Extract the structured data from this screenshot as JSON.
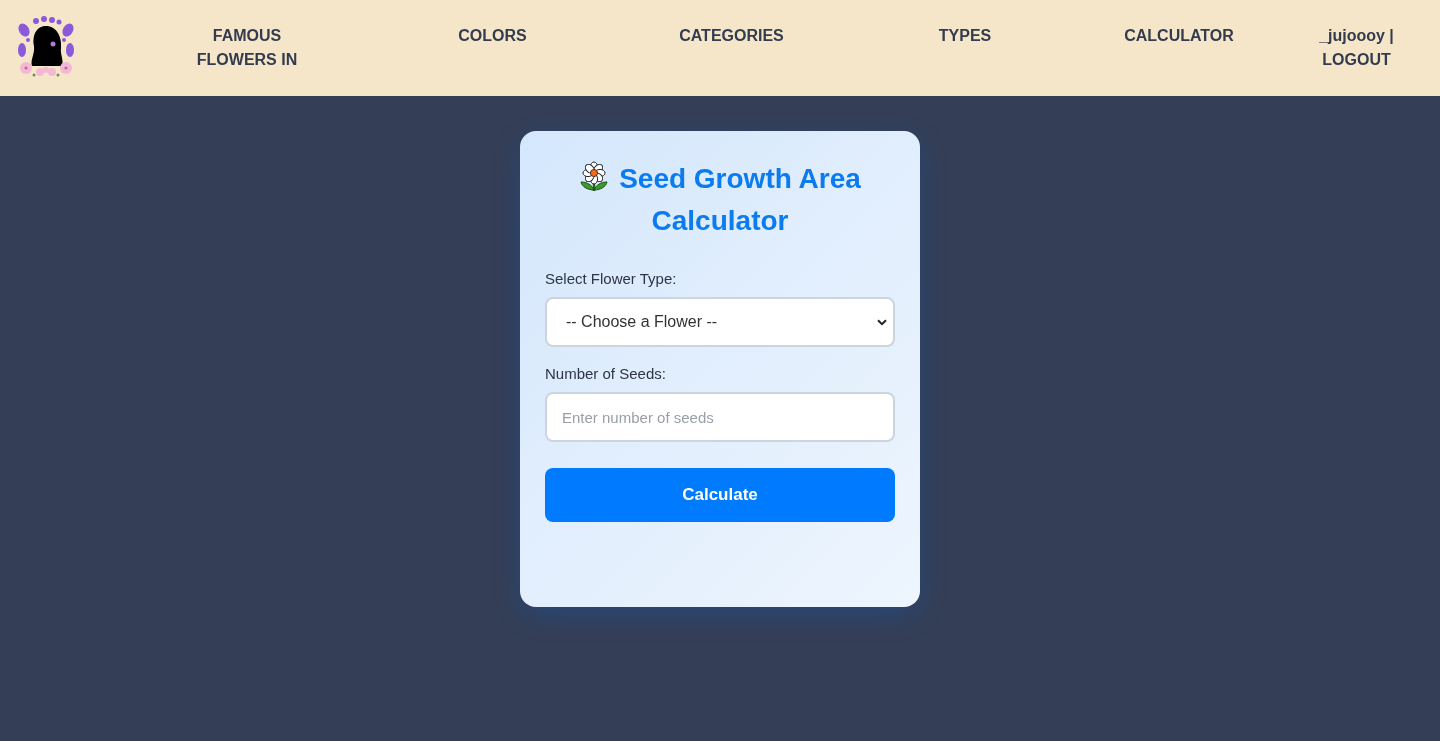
{
  "header": {
    "nav": [
      "FAMOUS FLOWERS IN",
      "COLORS",
      "CATEGORIES",
      "TYPES",
      "CALCULATOR"
    ],
    "user": {
      "name": "_jujoooy |",
      "logout": "LOGOUT"
    }
  },
  "calculator": {
    "title": "Seed Growth Area Calculator",
    "fields": [
      {
        "kind": "select",
        "label": "Select Flower Type:",
        "value": "-- Choose a Flower --"
      },
      {
        "kind": "input",
        "label": "Number of Seeds:",
        "placeholder": "Enter number of seeds"
      }
    ],
    "button": "Calculate"
  }
}
